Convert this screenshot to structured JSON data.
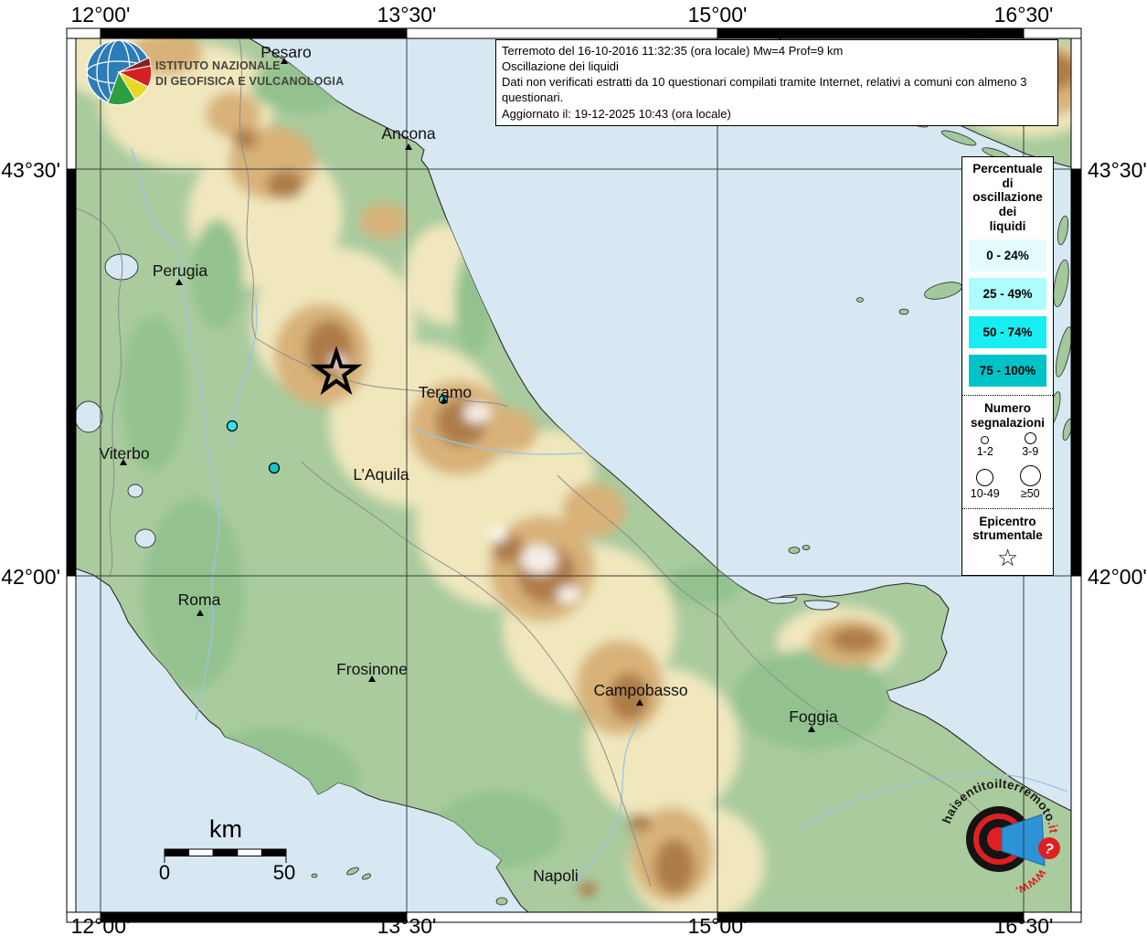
{
  "info_box": {
    "line1": "Terremoto del 16-10-2016 11:32:35 (ora locale) Mw=4 Prof=9 km",
    "line2": "Oscillazione dei liquidi",
    "line3": "Dati non verificati estratti da 10 questionari compilati tramite Internet, relativi a comuni con almeno 3 questionari.",
    "line4": "Aggiornato il: 19-12-2025 10:43 (ora locale)"
  },
  "legend": {
    "title_lines": [
      "Percentuale",
      "di",
      "oscillazione",
      "dei",
      "liquidi"
    ],
    "swatches": [
      {
        "label": "0 - 24%",
        "color": "#e4fbfe"
      },
      {
        "label": "25 - 49%",
        "color": "#adfdfe"
      },
      {
        "label": "50 - 74%",
        "color": "#18eef1"
      },
      {
        "label": "75 - 100%",
        "color": "#00c3c8"
      }
    ],
    "reports": {
      "title_line1": "Numero",
      "title_line2": "segnalazioni",
      "classes": [
        {
          "label": "1-2"
        },
        {
          "label": "3-9"
        },
        {
          "label": "10-49"
        },
        {
          "label": "≥50"
        }
      ]
    },
    "epicenter": {
      "title_line1": "Epicentro",
      "title_line2": "strumentale",
      "symbol": "☆"
    }
  },
  "axes": {
    "top": [
      "12°00'",
      "13°30'",
      "15°00'",
      "16°30'"
    ],
    "bottom": [
      "12°00'",
      "13°30'",
      "15°00'",
      "16°30'"
    ],
    "left": [
      "43°30'",
      "42°00'"
    ],
    "right": [
      "43°30'",
      "42°00'"
    ]
  },
  "cities": [
    {
      "name": "Pesaro"
    },
    {
      "name": "Ancona"
    },
    {
      "name": "Perugia"
    },
    {
      "name": "Viterbo"
    },
    {
      "name": "Teramo"
    },
    {
      "name": "L’Aquila"
    },
    {
      "name": "Roma"
    },
    {
      "name": "Frosinone"
    },
    {
      "name": "Campobasso"
    },
    {
      "name": "Foggia"
    },
    {
      "name": "Napoli"
    }
  ],
  "observations": [
    {
      "percent_class": "50 - 74%",
      "color": "#2fe3ee"
    },
    {
      "percent_class": "75 - 100%",
      "color": "#16c6cb"
    },
    {
      "percent_class": "50 - 74%",
      "color": "#2fe3ee"
    }
  ],
  "scale_bar": {
    "unit": "km",
    "start": "0",
    "end": "50"
  },
  "branding": {
    "ingv_line1": "ISTITUTO NAZIONALE",
    "ingv_line2": "DI GEOFISICA E VULCANOLOGIA",
    "site_text": "haisentitoilterremoto",
    "site_tld": ".it",
    "site_www": "www.",
    "site_q": "?"
  },
  "colors": {
    "sea": "#d7e8f3",
    "land": "#a9cb9e",
    "accent_red": "#e02020",
    "accent_blue": "#2e93d6"
  }
}
